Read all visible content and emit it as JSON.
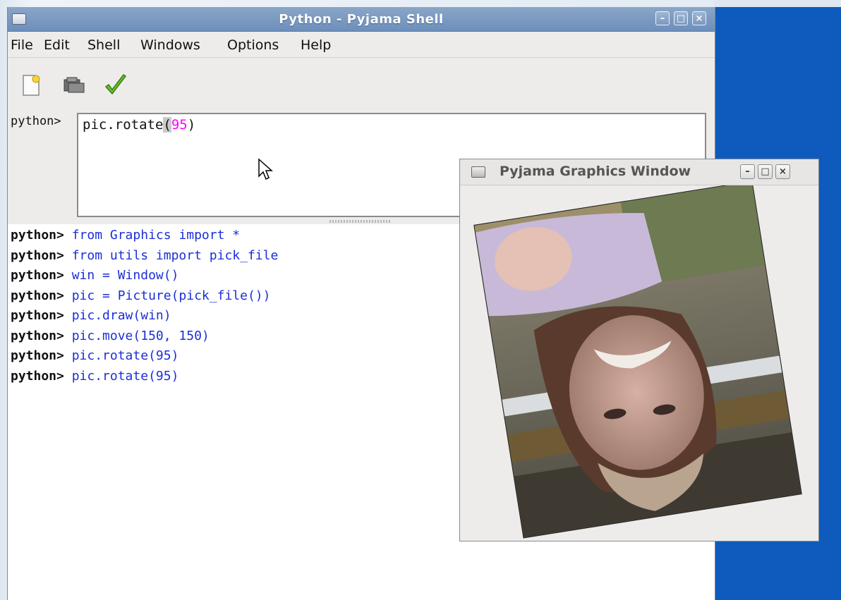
{
  "shell_window": {
    "title": "Python - Pyjama Shell",
    "controls": {
      "minimize": "–",
      "maximize": "□",
      "close": "×"
    }
  },
  "menubar": {
    "items": [
      "File",
      "Edit",
      "Shell",
      "Windows",
      "Options",
      "Help"
    ]
  },
  "toolbar": {
    "tools": [
      "new-file-icon",
      "open-folder-icon",
      "run-check-icon"
    ]
  },
  "prompt": {
    "label": "python>",
    "input_prefix": "pic.rotate",
    "input_paren_open": "(",
    "input_number": "95",
    "input_paren_close": ")"
  },
  "history": [
    {
      "prompt": "python>",
      "code": "from Graphics import *"
    },
    {
      "prompt": "python>",
      "code": "from utils import pick_file"
    },
    {
      "prompt": "python>",
      "code": "win = Window()"
    },
    {
      "prompt": "python>",
      "code": "pic = Picture(pick_file())"
    },
    {
      "prompt": "python>",
      "code": "pic.draw(win)"
    },
    {
      "prompt": "python>",
      "code": "pic.move(150, 150)"
    },
    {
      "prompt": "python>",
      "code": "pic.rotate(95)"
    },
    {
      "prompt": "python>",
      "code": "pic.rotate(95)"
    }
  ],
  "graphics_window": {
    "title": "Pyjama Graphics Window",
    "controls": {
      "minimize": "–",
      "maximize": "□",
      "close": "×"
    }
  },
  "colors": {
    "desktop_accent": "#0e5bbd",
    "code_text": "#1c2fd6",
    "number_highlight": "#ff00ff"
  }
}
